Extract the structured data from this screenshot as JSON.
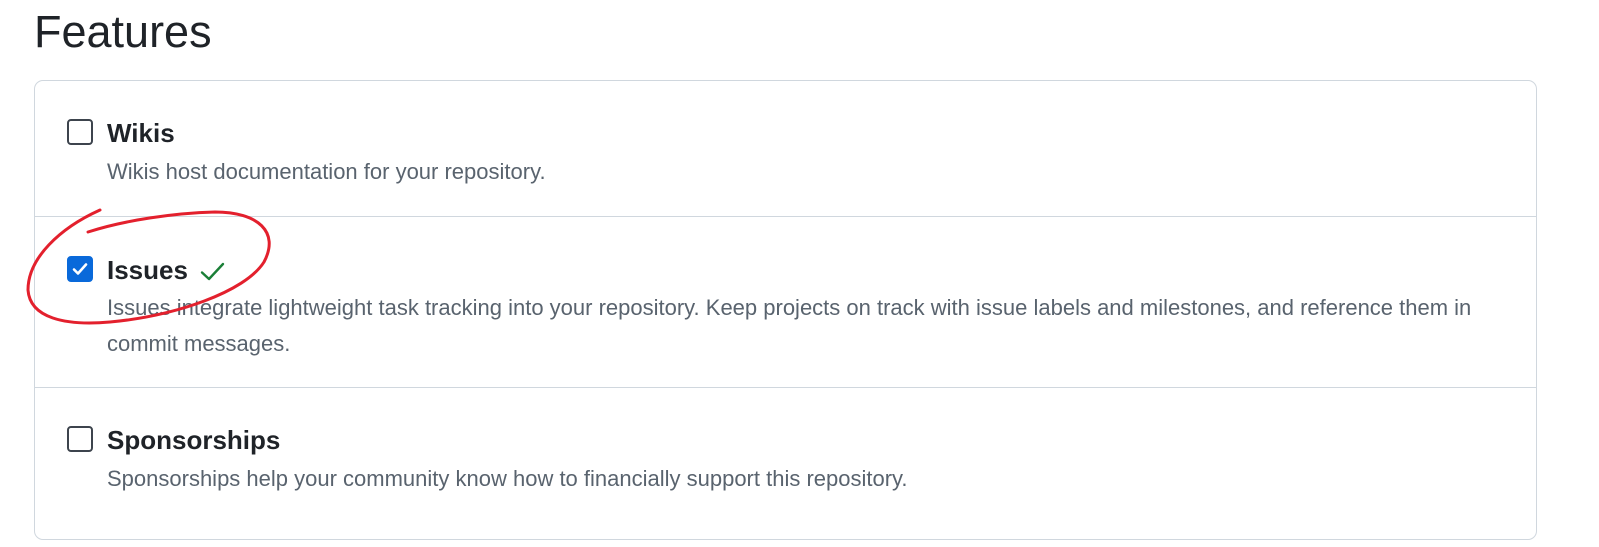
{
  "page": {
    "title": "Features"
  },
  "features": [
    {
      "label": "Wikis",
      "description": "Wikis host documentation for your repository.",
      "checked": false
    },
    {
      "label": "Issues",
      "description": "Issues integrate lightweight task tracking into your repository. Keep projects on track with issue labels and milestones, and reference them in commit messages.",
      "checked": true,
      "status_icon": "check-icon"
    },
    {
      "label": "Sponsorships",
      "description": "Sponsorships help your community know how to financially support this repository.",
      "checked": false
    }
  ],
  "colors": {
    "accent": "#0969da",
    "success": "#1a7f37",
    "annotation": "#e3202d",
    "border": "#d0d7de",
    "muted_text": "#59636e"
  }
}
